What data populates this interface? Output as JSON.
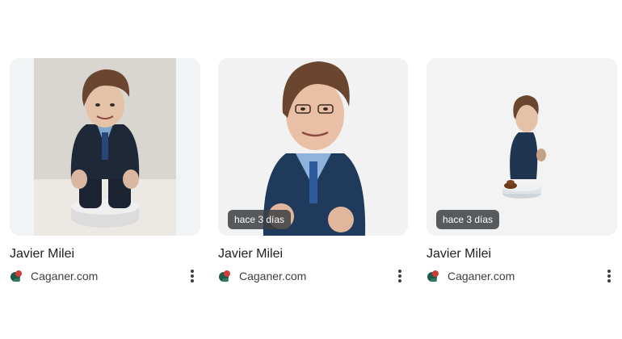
{
  "results": [
    {
      "title": "Javier Milei",
      "source": "Caganer.com",
      "badge": "",
      "favicon": "caganer-favicon"
    },
    {
      "title": "Javier Milei",
      "source": "Caganer.com",
      "badge": "hace 3 días",
      "favicon": "caganer-favicon"
    },
    {
      "title": "Javier Milei",
      "source": "Caganer.com",
      "badge": "hace 3 días",
      "favicon": "caganer-favicon"
    }
  ],
  "colors": {
    "card_bg": "#f1f3f4",
    "title": "#202124",
    "source": "#3c4043",
    "badge_bg": "#3c4043",
    "suit": "#1f3550",
    "tie": "#2f5a9c",
    "hair": "#6a4630"
  },
  "icons": {
    "more": "more-vert-icon",
    "favicon": "caganer-favicon"
  }
}
